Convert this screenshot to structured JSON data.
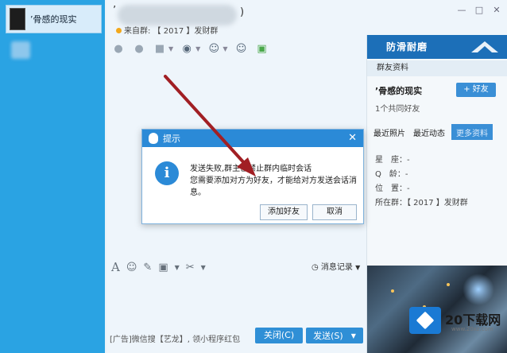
{
  "contact_list": {
    "selected_contact": "’骨感的现实"
  },
  "chat_window": {
    "title_prefix": "’",
    "title_suffix": ")",
    "subtitle": "来自群: 【 2017 】发财群",
    "history_label": "消息记录",
    "ad_text": "[广告]微信搜【艺龙】, 领小程序红包",
    "close_button": "关闭(C)",
    "send_button": "发送(S)"
  },
  "right_panel": {
    "banner_text": "防滑耐磨",
    "tab": "群友资料",
    "name": "’骨感的现实",
    "add_friend": "+ 好友",
    "common_friends": "1个共同好友",
    "tabs": [
      "最近照片",
      "最近动态",
      "更多资料"
    ],
    "info": [
      {
        "label": "星　座：",
        "value": "-"
      },
      {
        "label": "Q　龄：",
        "value": "-"
      },
      {
        "label": "位　置：",
        "value": "-"
      },
      {
        "label": "所在群：",
        "value": "【 2017 】发财群"
      }
    ]
  },
  "dialog": {
    "title": "提示",
    "message_line1": "发送失败,群主已禁止群内临时会话",
    "message_line2": "您需要添加对方为好友，才能给对方发送会话消息。",
    "add_friend_button": "添加好友",
    "cancel_button": "取消"
  },
  "watermark": {
    "brand": "20下载网",
    "url": "www.20xz.com"
  },
  "colors": {
    "accent_blue": "#2b8ad7",
    "sidebar_blue": "#2aa3e3",
    "arrow_red": "#a11f24"
  }
}
